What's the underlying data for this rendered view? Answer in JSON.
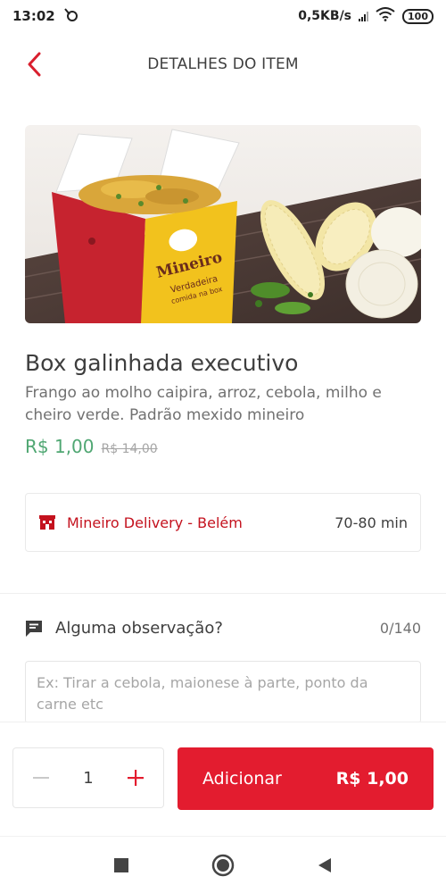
{
  "status_bar": {
    "time": "13:02",
    "speed": "0,5KB/s",
    "battery": "100"
  },
  "header": {
    "title": "DETALHES DO ITEM",
    "back_icon": "chevron-left-icon"
  },
  "item": {
    "name": "Box galinhada executivo",
    "description": "Frango ao molho caipira, arroz, cebola, milho e cheiro verde. Padrão mexido mineiro",
    "price": "R$ 1,00",
    "old_price": "R$ 14,00",
    "image_box_text_1": "Mineiro",
    "image_box_text_2": "Verdadeira",
    "image_box_text_3": "comida na box"
  },
  "store": {
    "name": "Mineiro Delivery - Belém",
    "delivery_time": "70-80 min",
    "icon": "store-icon"
  },
  "observation": {
    "title": "Alguma observação?",
    "count": "0/140",
    "placeholder": "Ex: Tirar a cebola, maionese à parte, ponto da carne etc",
    "icon": "comment-icon"
  },
  "order": {
    "quantity": "1",
    "add_label": "Adicionar",
    "add_price": "R$ 1,00"
  },
  "colors": {
    "brand_red": "#e31c2f",
    "price_green": "#50a773",
    "store_red": "#c4121e"
  }
}
